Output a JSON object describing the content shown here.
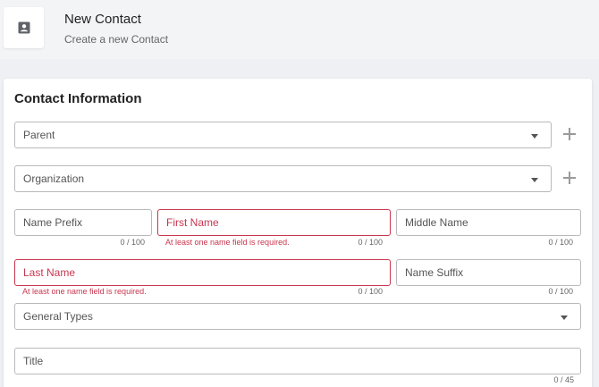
{
  "header": {
    "title": "New Contact",
    "subtitle": "Create a new Contact",
    "icon": "contact-card-icon"
  },
  "card": {
    "title": "Contact Information"
  },
  "fields": {
    "parent": {
      "label": "Parent"
    },
    "organization": {
      "label": "Organization"
    },
    "name_prefix": {
      "label": "Name Prefix",
      "counter": "0 / 100"
    },
    "first_name": {
      "label": "First Name",
      "counter": "0 / 100",
      "error": "At least one name field is required."
    },
    "middle_name": {
      "label": "Middle Name",
      "counter": "0 / 100"
    },
    "last_name": {
      "label": "Last Name",
      "counter": "0 / 100",
      "error": "At least one name field is required."
    },
    "name_suffix": {
      "label": "Name Suffix",
      "counter": "0 / 100"
    },
    "general_types": {
      "label": "General Types"
    },
    "title": {
      "label": "Title",
      "counter": "0 / 45"
    }
  },
  "colors": {
    "error": "#c8364f",
    "border": "#b9b9b9"
  }
}
